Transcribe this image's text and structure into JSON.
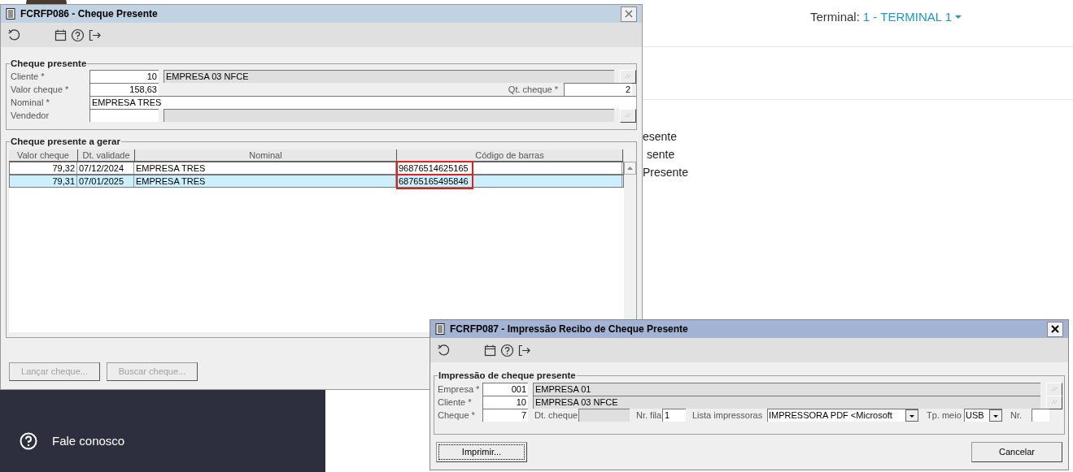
{
  "background": {
    "terminal_label": "Terminal:",
    "terminal_value": "1 - TERMINAL 1",
    "menu_fragments": [
      "esente",
      "sente",
      "Presente"
    ],
    "sidebar_items": [
      {
        "label": "Fale conosco"
      }
    ]
  },
  "window_1": {
    "title": "FCRFP086 - Cheque Presente",
    "group_1": {
      "title": "Cheque presente",
      "cliente": {
        "label": "Cliente *",
        "code": "10",
        "name": "EMPRESA 03 NFCE"
      },
      "valor": {
        "label": "Valor cheque *",
        "value": "158,63"
      },
      "qt": {
        "label": "Qt. cheque *",
        "value": "2"
      },
      "nominal": {
        "label": "Nominal *",
        "value": "EMPRESA TRES"
      },
      "vendedor": {
        "label": "Vendedor"
      }
    },
    "group_2": {
      "title": "Cheque presente a gerar",
      "columns": [
        "Valor cheque",
        "Dt. validade",
        "Nominal",
        "Código de barras"
      ],
      "rows": [
        {
          "cells": [
            "79,32",
            "07/12/2024",
            "EMPRESA TRES",
            "96876514625165"
          ],
          "selected": false,
          "barcode_highlighted": true
        },
        {
          "cells": [
            "79,31",
            "07/01/2025",
            "EMPRESA TRES",
            "68765165495846"
          ],
          "selected": true,
          "barcode_highlighted": true
        }
      ]
    },
    "buttons": [
      {
        "label": "Lançar cheque...",
        "disabled": true
      },
      {
        "label": "Buscar cheque...",
        "disabled": true
      }
    ]
  },
  "window_2": {
    "title": "FCRFP087 - Impressão Recibo de Cheque Presente",
    "group": {
      "title": "Impressão de cheque presente",
      "empresa": {
        "label": "Empresa *",
        "code": "001",
        "name": "EMPRESA 01"
      },
      "cliente": {
        "label": "Cliente *",
        "code": "10",
        "name": "EMPRESA 03 NFCE"
      },
      "cheque": {
        "label": "Cheque *",
        "code": "7"
      },
      "dt_cheque": {
        "label": "Dt. cheque"
      },
      "nr_fila": {
        "label": "Nr. fila",
        "value": "1"
      },
      "lista_impressoras": {
        "label": "Lista impressoras",
        "value": "IMPRESSORA PDF <Microsoft"
      },
      "tp_meio": {
        "label": "Tp. meio",
        "value": "USB"
      },
      "nr": {
        "label": "Nr."
      }
    },
    "buttons": [
      {
        "label": "Imprimir...",
        "focused": true
      },
      {
        "label": "Cancelar",
        "focused": false
      }
    ]
  }
}
